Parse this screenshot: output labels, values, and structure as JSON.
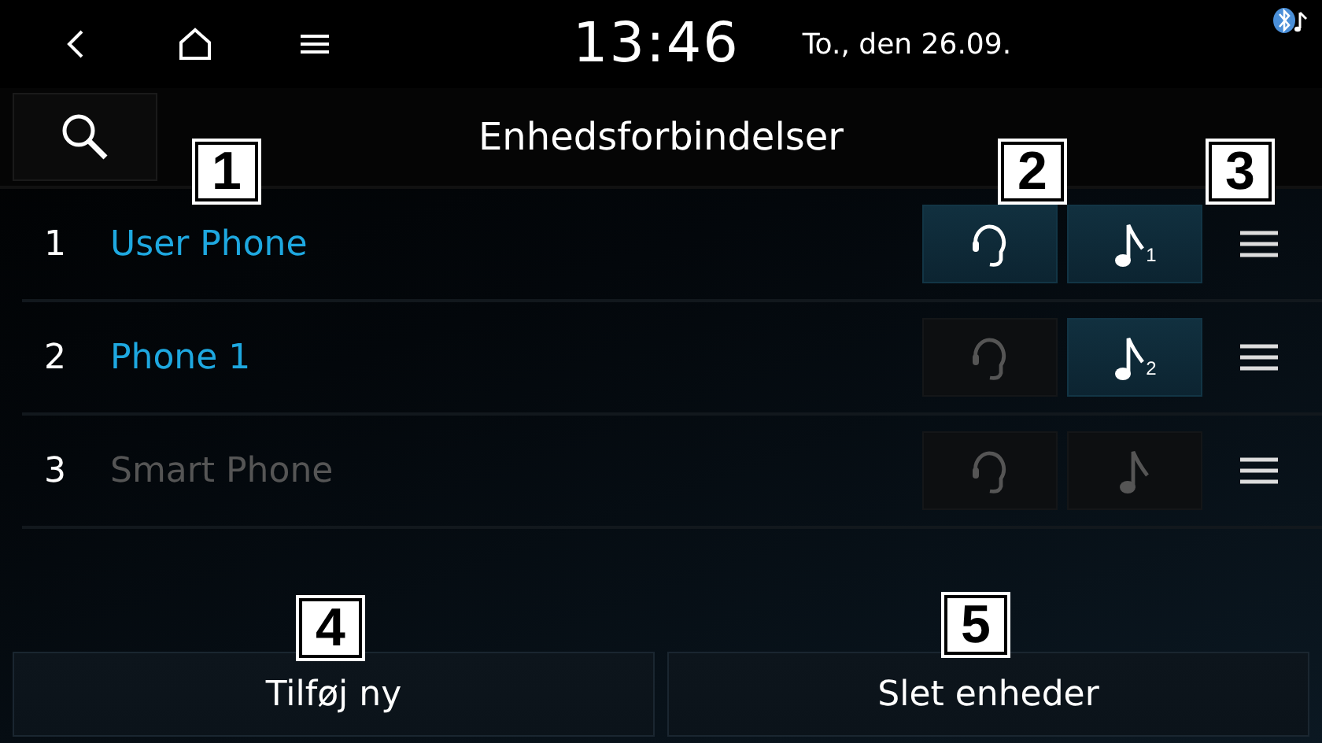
{
  "status_bar": {
    "time": "13:46",
    "date": "To., den 26.09."
  },
  "header": {
    "title": "Enhedsforbindelser"
  },
  "devices": [
    {
      "number": "1",
      "name": "User Phone",
      "connected": true,
      "phone_on": true,
      "audio_on": true,
      "audio_index": "1"
    },
    {
      "number": "2",
      "name": "Phone 1",
      "connected": true,
      "phone_on": false,
      "audio_on": true,
      "audio_index": "2"
    },
    {
      "number": "3",
      "name": "Smart Phone",
      "connected": false,
      "phone_on": false,
      "audio_on": false
    }
  ],
  "buttons": [
    "Tilføj ny",
    "Slet enheder"
  ],
  "callouts": [
    "1",
    "2",
    "3",
    "4",
    "5"
  ]
}
